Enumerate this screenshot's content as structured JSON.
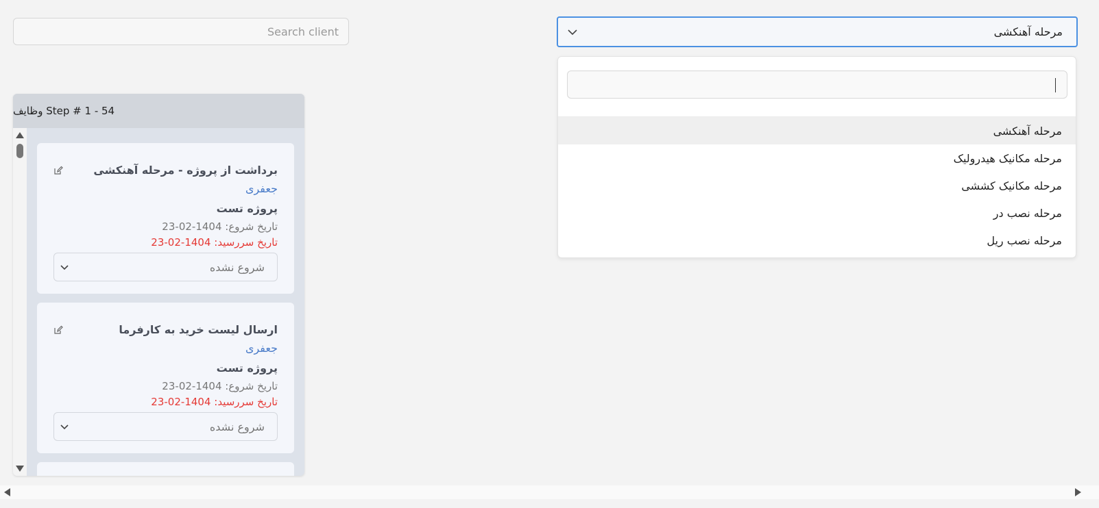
{
  "search": {
    "placeholder": "Search client"
  },
  "stage_select": {
    "selected": "مرحله آهنکشی",
    "search_value": "",
    "options": [
      "مرحله آهنکشی",
      "مرحله مکانیک هیدرولیک",
      "مرحله مکانیک کششی",
      "مرحله نصب در",
      "مرحله نصب ریل"
    ],
    "highlighted_index": 0
  },
  "panel": {
    "header": "54 - Step # 1 وظایف",
    "tasks": [
      {
        "title": "برداشت از پروژه - مرحله آهنکشی",
        "person": "جعفری",
        "project": "پروژه تست",
        "start": "تاریخ شروع: 1404-02-23",
        "due": "تاریخ سررسید: 1404-02-23",
        "status": "شروع نشده"
      },
      {
        "title": "ارسال لیست خرید به کارفرما",
        "person": "جعفری",
        "project": "پروژه تست",
        "start": "تاریخ شروع: 1404-02-23",
        "due": "تاریخ سررسید: 1404-02-23",
        "status": "شروع نشده"
      }
    ]
  },
  "icons": {
    "chevron": "chevron-down-icon",
    "edit": "edit-icon"
  },
  "colors": {
    "focus_border": "#4a90e2",
    "person_link": "#4a7cc9",
    "due_date": "#e53935",
    "panel_bg": "#dde2ea"
  }
}
